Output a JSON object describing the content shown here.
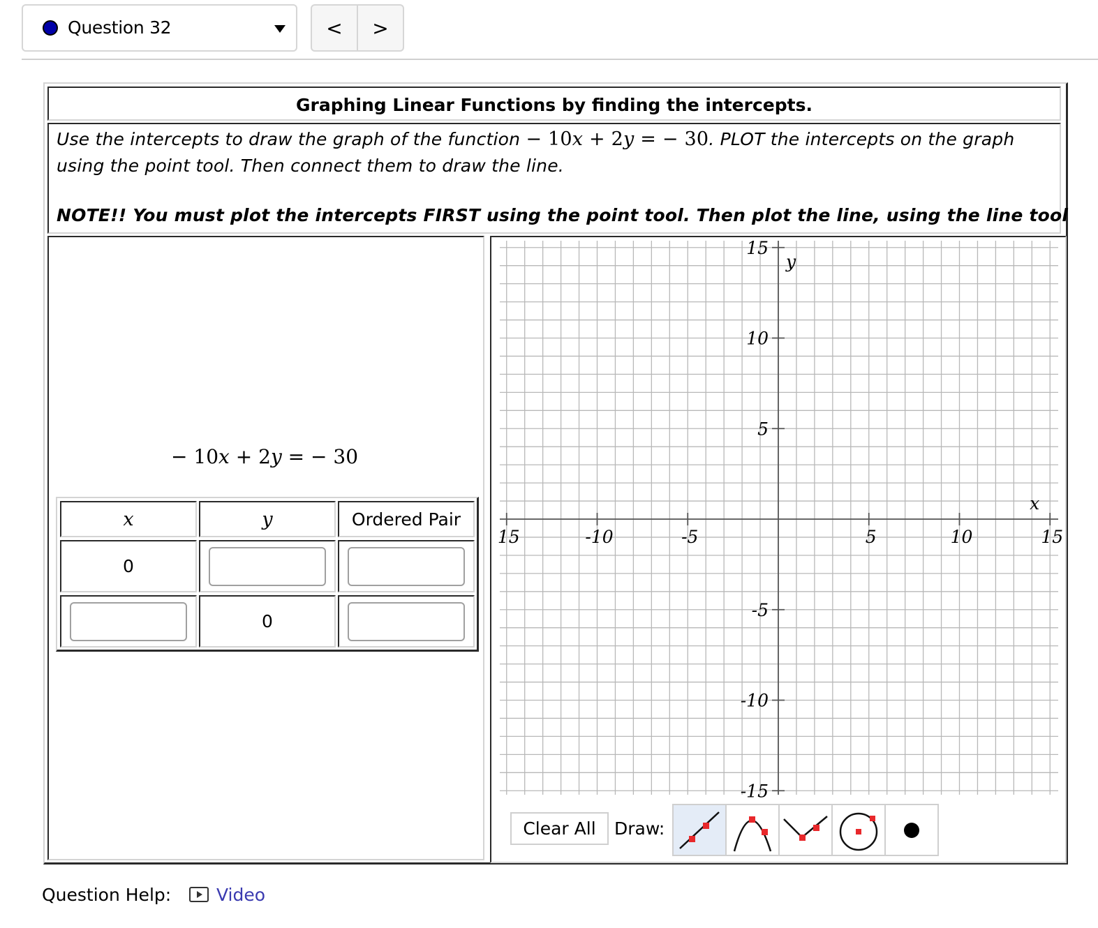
{
  "header": {
    "question_label": "Question 32",
    "status_dot_color": "#0000a8",
    "prev_label": "<",
    "next_label": ">"
  },
  "problem": {
    "title": "Graphing Linear Functions by finding the intercepts.",
    "instruction_line1_pre": "Use the intercepts to draw the graph of the function ",
    "instruction_equation": "− 10x + 2y =  − 30",
    "instruction_line1_post": ". PLOT the intercepts on the graph",
    "instruction_line2": "using the point tool. Then connect them to draw the line.",
    "note": "NOTE!! You must plot the intercepts FIRST using the point tool. Then plot the line, using the line tool"
  },
  "equation": {
    "display": "− 10x + 2y =  − 30",
    "a": -10,
    "b": 2,
    "c": -30
  },
  "intercept_table": {
    "headers": [
      "x",
      "y",
      "Ordered Pair"
    ],
    "rows": [
      {
        "x": "0",
        "y": "",
        "pair": ""
      },
      {
        "x": "",
        "y": "0",
        "pair": ""
      }
    ]
  },
  "graph": {
    "xlabel": "x",
    "ylabel": "y",
    "xlim": [
      -15,
      15
    ],
    "ylim": [
      -15,
      15
    ],
    "grid_step": 1,
    "tick_step": 5,
    "x_tick_labels": [
      "15",
      "-10",
      "-5",
      "5",
      "10",
      "15"
    ],
    "y_tick_labels": [
      "15",
      "10",
      "5",
      "-5",
      "-10",
      "-15"
    ],
    "grid_color": "#b8b8b8",
    "axis_color": "#555555"
  },
  "toolbar": {
    "clear_label": "Clear All",
    "draw_label": "Draw:",
    "tools": [
      {
        "name": "line",
        "active": true
      },
      {
        "name": "parabola",
        "active": false
      },
      {
        "name": "absolute-value",
        "active": false
      },
      {
        "name": "circle",
        "active": false
      },
      {
        "name": "point",
        "active": false
      }
    ],
    "marker_color": "#e8282b"
  },
  "help": {
    "label": "Question Help:",
    "video_label": "Video",
    "link_color": "#3a3ab0"
  }
}
